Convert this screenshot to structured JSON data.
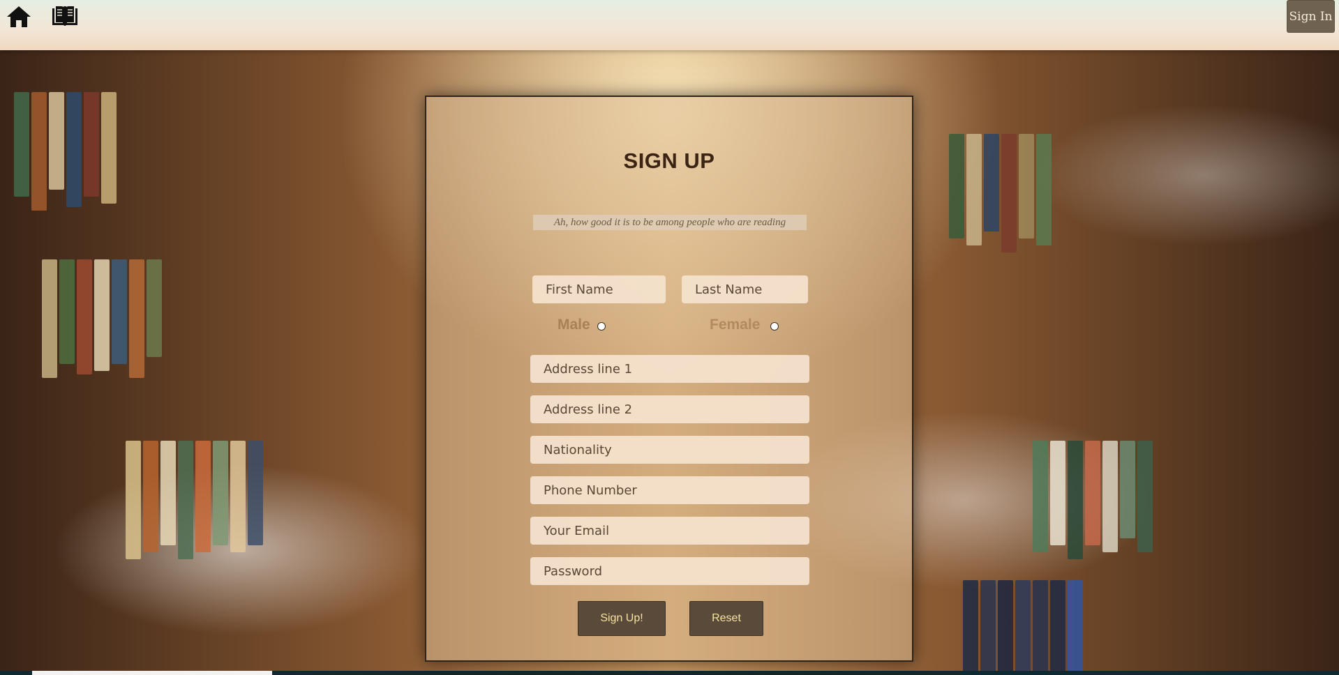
{
  "nav": {
    "home_icon": "home-icon",
    "book_icon": "open-book-icon",
    "sign_in_label": "Sign In"
  },
  "form": {
    "title": "SIGN UP",
    "quote": "Ah, how good it is to be among people who are reading",
    "first_name_placeholder": "First Name",
    "last_name_placeholder": "Last Name",
    "gender": {
      "male_label": "Male",
      "female_label": "Female"
    },
    "address1_placeholder": "Address line 1",
    "address2_placeholder": "Address line 2",
    "nationality_placeholder": "Nationality",
    "phone_placeholder": "Phone Number",
    "email_placeholder": "Your Email",
    "password_placeholder": "Password",
    "submit_label": "Sign Up!",
    "reset_label": "Reset"
  },
  "colors": {
    "navbar": "#f2e6d6",
    "sign_in_button": "#6f6250",
    "card_overlay": "#debe96",
    "button": "#5a4a3a",
    "button_text": "#f6e3a3"
  }
}
